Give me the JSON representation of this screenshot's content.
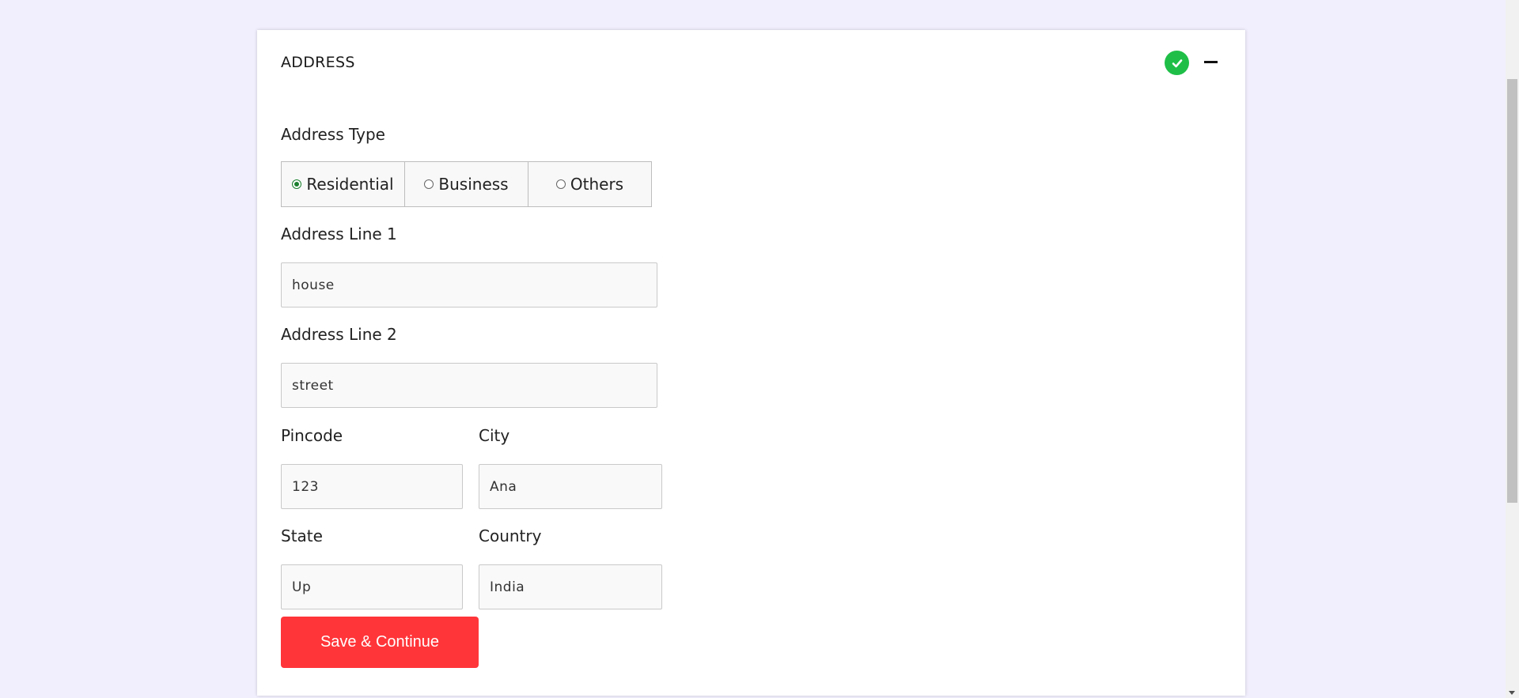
{
  "section": {
    "title": "ADDRESS",
    "status_icon": "check-circle-icon",
    "collapse_icon": "minus-icon",
    "status_color": "#1fbf47"
  },
  "address_type": {
    "label": "Address Type",
    "options": [
      "Residential",
      "Business",
      "Others"
    ],
    "selected": "Residential"
  },
  "fields": {
    "address_line_1": {
      "label": "Address Line 1",
      "value": "house"
    },
    "address_line_2": {
      "label": "Address Line 2",
      "value": "street"
    },
    "pincode": {
      "label": "Pincode",
      "value": "123"
    },
    "city": {
      "label": "City",
      "value": "Ana"
    },
    "state": {
      "label": "State",
      "value": "Up"
    },
    "country": {
      "label": "Country",
      "value": "India"
    }
  },
  "actions": {
    "save_label": "Save & Continue",
    "save_color": "#ff3539"
  }
}
